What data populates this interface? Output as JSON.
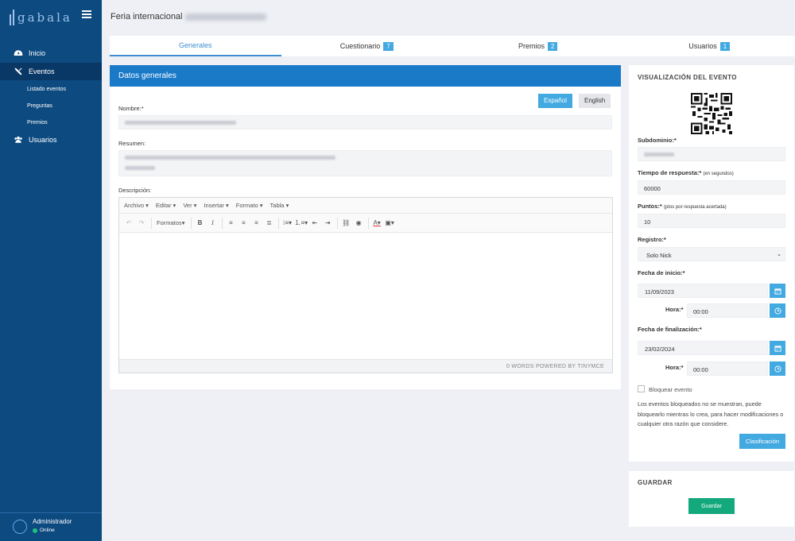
{
  "sidebar": {
    "logo_text": "gabala",
    "items": [
      {
        "label": "Inicio",
        "icon": "dashboard-icon"
      },
      {
        "label": "Eventos",
        "icon": "tools-icon"
      },
      {
        "label": "Usuarios",
        "icon": "users-icon"
      }
    ],
    "sub_items": [
      "Listado eventos",
      "Preguntas",
      "Premios"
    ],
    "user": {
      "name": "Administrador",
      "status": "Online"
    }
  },
  "header": {
    "title": "Feria internacional"
  },
  "tabs": [
    {
      "label": "Generales"
    },
    {
      "label": "Cuestionario",
      "badge": "7"
    },
    {
      "label": "Premios",
      "badge": "2"
    },
    {
      "label": "Usuarios",
      "badge": "1"
    }
  ],
  "general": {
    "heading": "Datos generales",
    "lang_es": "Español",
    "lang_en": "English",
    "name_label": "Nombre:*",
    "summary_label": "Resumen:",
    "description_label": "Descripción:"
  },
  "editor": {
    "menus": [
      "Archivo",
      "Editar",
      "Ver",
      "Insertar",
      "Formato",
      "Tabla"
    ],
    "formats_label": "Formatos",
    "status": "0 WORDS POWERED BY TINYMCE"
  },
  "visual": {
    "heading": "VISUALIZACIÓN DEL EVENTO",
    "subdomain_label": "Subdominio:*",
    "time_label": "Tiempo de respuesta:*",
    "time_hint": "(en segundos)",
    "time_value": "60000",
    "points_label": "Puntos:*",
    "points_hint": "(ptos por respuesta acertada)",
    "points_value": "10",
    "register_label": "Registro:*",
    "register_value": "Solo Nick",
    "start_label": "Fecha de inicio:*",
    "start_date": "11/09/2023",
    "hour_label": "Hora:*",
    "start_time": "00:00",
    "end_label": "Fecha de finalización:*",
    "end_date": "23/02/2024",
    "end_time": "00:00",
    "block_label": "Bloquear evento",
    "block_note": "Los eventos bloqueados no se muestran, puede bloquearlo mientras lo crea, para hacer modificaciones o cualquier otra razón que considere.",
    "classification_btn": "Clasificación"
  },
  "save": {
    "heading": "GUARDAR",
    "button": "Guardar"
  },
  "colors": {
    "sidebar": "#0d4a80",
    "accent": "#42a9e1",
    "header_blue": "#1b7ac8",
    "save_green": "#13a97c"
  }
}
